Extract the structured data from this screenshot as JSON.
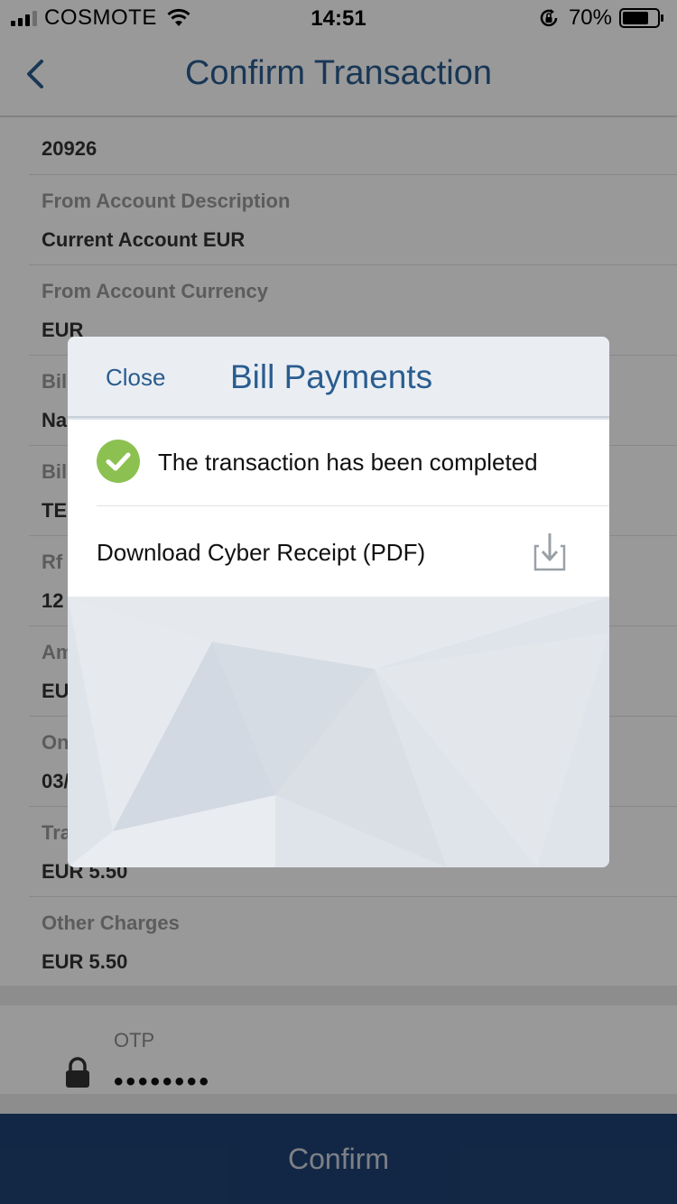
{
  "status_bar": {
    "carrier": "COSMOTE",
    "time": "14:51",
    "battery": "70%"
  },
  "nav": {
    "title": "Confirm Transaction"
  },
  "details": [
    {
      "label": "",
      "value": "20926"
    },
    {
      "label": "From Account Description",
      "value": "Current Account EUR"
    },
    {
      "label": "From Account Currency",
      "value": "EUR"
    },
    {
      "label": "Bil",
      "value": "Na"
    },
    {
      "label": "Bil",
      "value": "TE"
    },
    {
      "label": "Rf",
      "value": "12"
    },
    {
      "label": "Am",
      "value": "EU"
    },
    {
      "label": "On",
      "value": "03/"
    },
    {
      "label": "Tra",
      "value": "EUR 5.50"
    },
    {
      "label": "Other Charges",
      "value": "EUR 5.50"
    }
  ],
  "otp": {
    "label": "OTP",
    "value": "••••••••"
  },
  "confirm_label": "Confirm",
  "modal": {
    "close_label": "Close",
    "title": "Bill Payments",
    "status_text": "The transaction has been completed",
    "download_label": "Download Cyber Receipt (PDF)"
  },
  "colors": {
    "accent": "#2a5d8f",
    "confirm_bar": "#1f4273",
    "success": "#8cc152"
  },
  "icons": {
    "back": "chevron-left-icon",
    "lock": "lock-icon",
    "check": "check-circle-icon",
    "download": "download-icon"
  }
}
